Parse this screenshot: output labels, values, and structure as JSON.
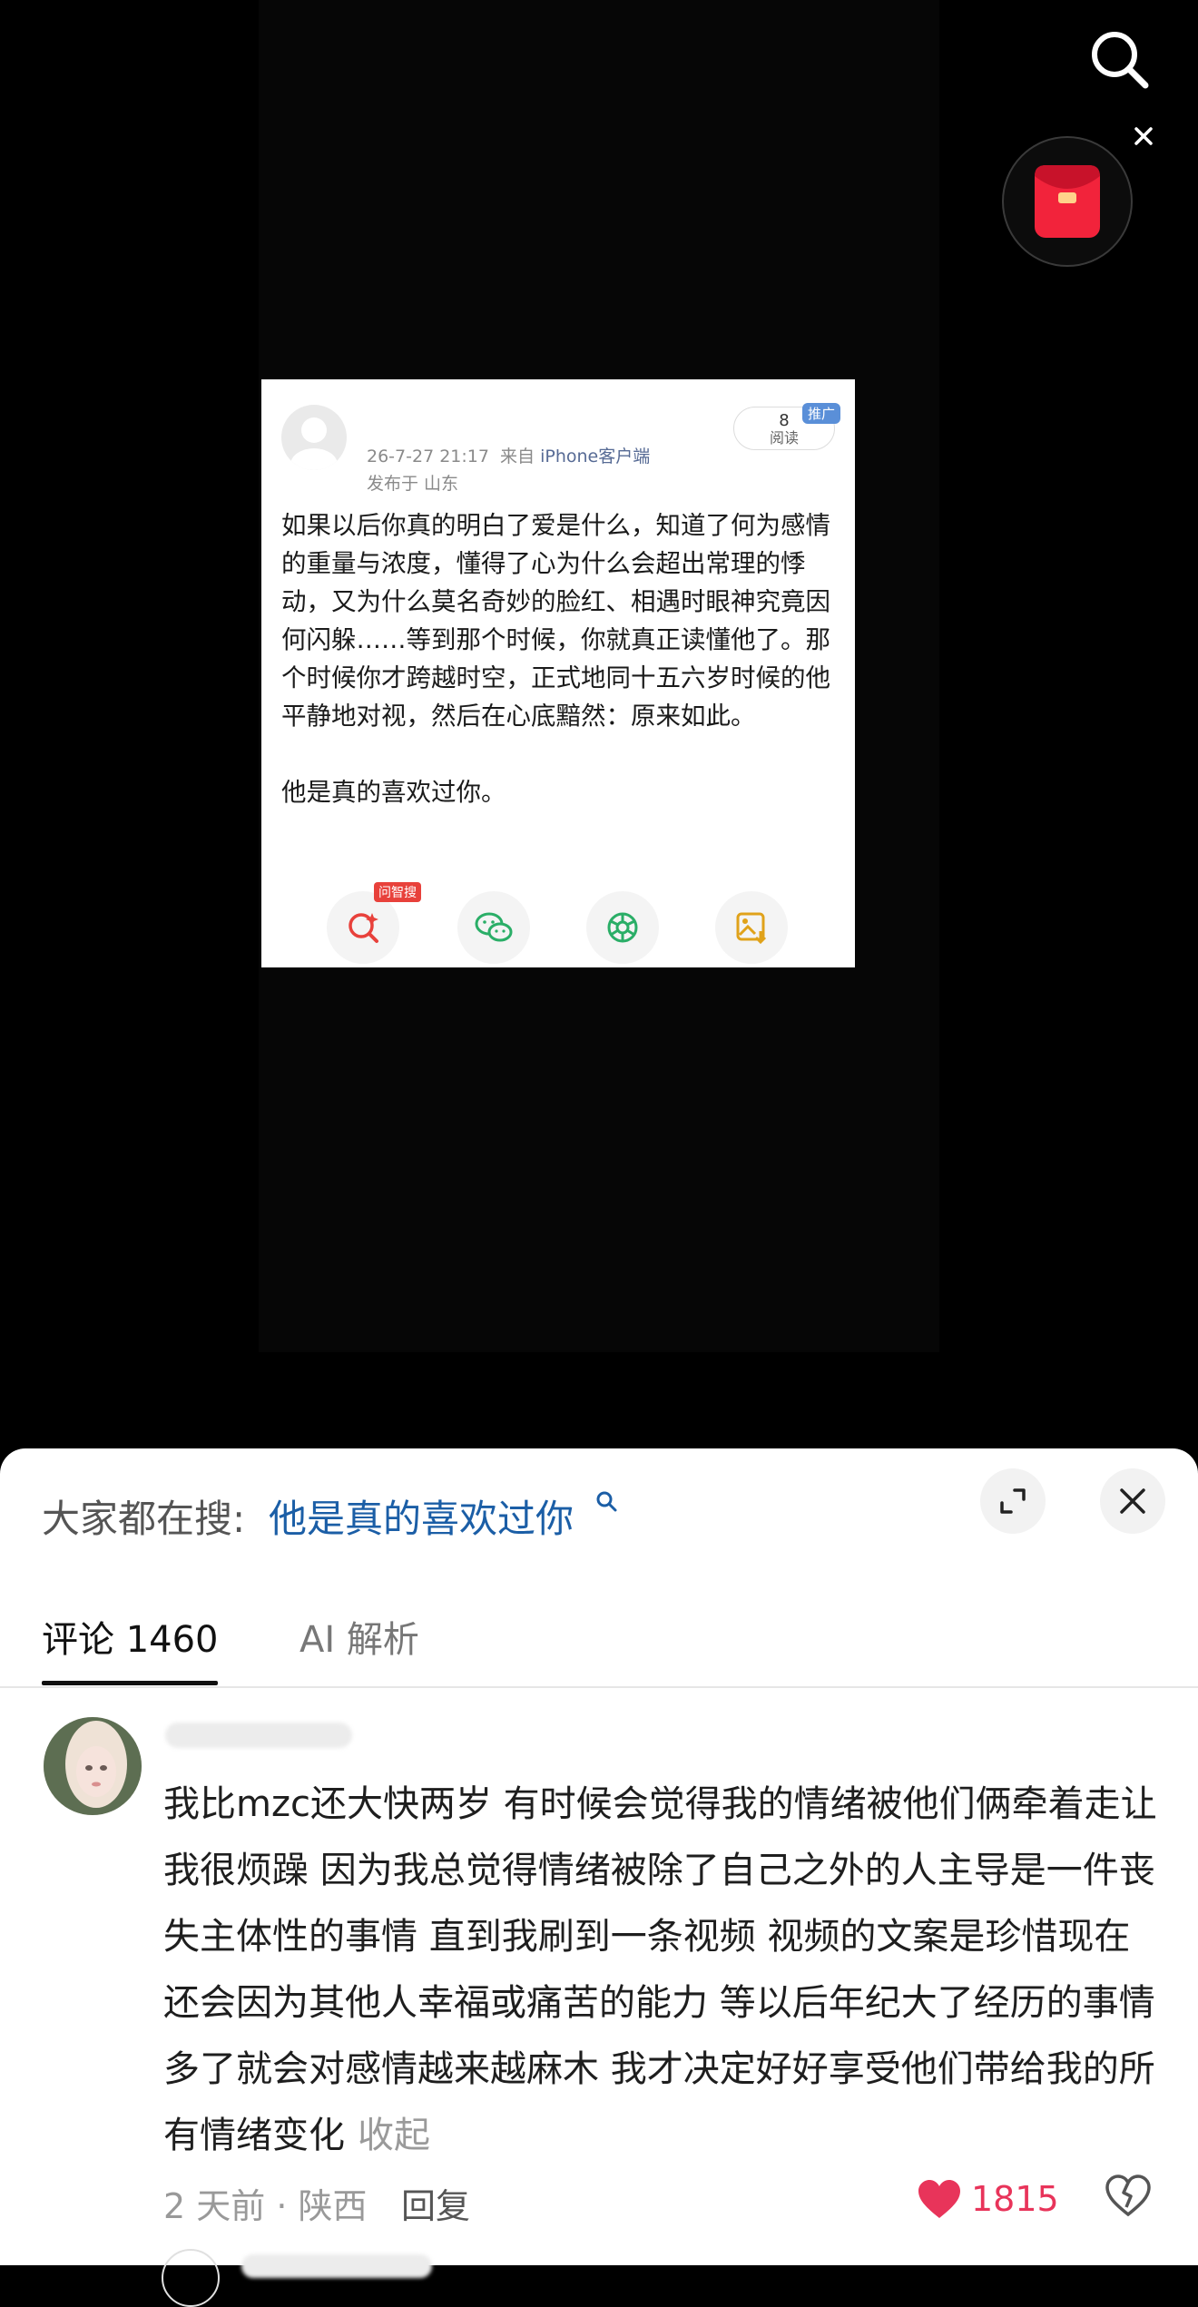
{
  "card": {
    "meta_time": "26-7-27 21:17",
    "meta_from_prefix": "来自",
    "meta_from_source": "iPhone客户端",
    "location": "发布于 山东",
    "read_count": "8",
    "read_label": "阅读",
    "promo_badge": "推广",
    "body": "如果以后你真的明白了爱是什么，知道了何为感情的重量与浓度，懂得了心为什么会超出常理的悸动，又为什么莫名奇妙的脸红、相遇时眼神究竟因何闪躲……等到那个时候，你就真正读懂他了。那个时候你才跨越时空，正式地同十五六岁时候的他平静地对视，然后在心底黯然：原来如此。\n\n他是真的喜欢过你。",
    "zhisou_badge": "问智搜",
    "actions": [
      {
        "icon": "ai-search-icon",
        "color": "#e8413b"
      },
      {
        "icon": "wechat-icon",
        "color": "#2aae67"
      },
      {
        "icon": "moments-icon",
        "color": "#2aae67"
      },
      {
        "icon": "save-image-icon",
        "color": "#e0a21a"
      }
    ]
  },
  "sheet": {
    "hot_label": "大家都在搜:",
    "hot_query": "他是真的喜欢过你",
    "tabs": {
      "comments": "评论 1460",
      "ai": "AI 解析"
    }
  },
  "comment": {
    "text": "我比mzc还大快两岁  有时候会觉得我的情绪被他们俩牵着走让我很烦躁  因为我总觉得情绪被除了自己之外的人主导是一件丧失主体性的事情   直到我刷到一条视频 视频的文案是珍惜现在还会因为其他人幸福或痛苦的能力 等以后年纪大了经历的事情多了就会对感情越来越麻木 我才决定好好享受他们带给我的所有情绪变化",
    "collapse": "收起",
    "meta": "2 天前 · 陕西",
    "reply": "回复",
    "likes": "1815"
  },
  "colors": {
    "accent_link": "#1b5ea6",
    "like_red": "#e8345a"
  }
}
